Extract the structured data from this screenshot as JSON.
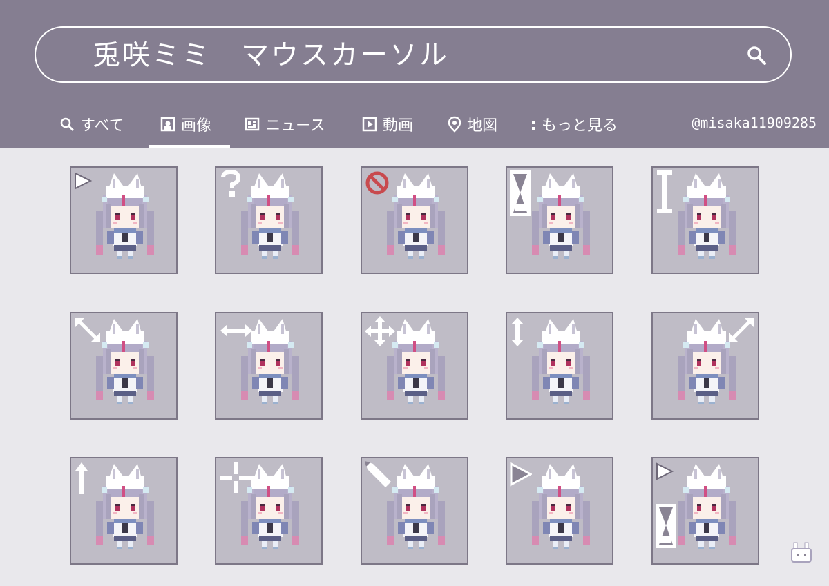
{
  "search": {
    "query": "兎咲ミミ　マウスカーソル"
  },
  "tabs": [
    {
      "label": "すべて",
      "icon": "search-icon"
    },
    {
      "label": "画像",
      "icon": "image-icon"
    },
    {
      "label": "ニュース",
      "icon": "news-icon"
    },
    {
      "label": "動画",
      "icon": "play-icon"
    },
    {
      "label": "地図",
      "icon": "map-pin-icon"
    },
    {
      "label": "もっと見る",
      "icon": "more-icon"
    }
  ],
  "active_tab": "画像",
  "credit": "@misaka11909285",
  "colors": {
    "header": "#857e91",
    "page": "#e9e8ec",
    "tile": "#bfbcc6",
    "tile_border": "#7d7787",
    "accent_red": "#c84a4e"
  },
  "cursors": [
    "arrow-cursor-icon",
    "help-cursor-icon",
    "unavailable-cursor-icon",
    "busy-hourglass-cursor-icon",
    "text-select-cursor-icon",
    "diagonal-resize-cursor-icon",
    "horizontal-resize-cursor-icon",
    "move-cursor-icon",
    "vertical-resize-cursor-icon",
    "diagonal-resize-alt-cursor-icon",
    "alternate-select-cursor-icon",
    "precision-cursor-icon",
    "handwriting-cursor-icon",
    "link-select-cursor-icon",
    "working-in-background-cursor-icon"
  ]
}
